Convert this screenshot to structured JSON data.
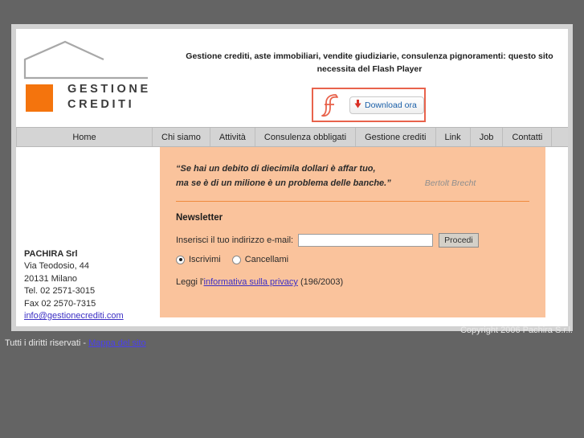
{
  "header": {
    "tagline": "Gestione crediti, aste immobiliari, vendite giudiziarie, consulenza pignoramenti: questo sito necessita del Flash Player",
    "logo_line1": "GESTIONE",
    "logo_line2": "CREDITI",
    "logo_mark_color": "#f4740d",
    "house_icon": "house-outline-icon"
  },
  "flash": {
    "logo_icon": "flash-f-icon",
    "arrow_icon": "download-arrow-icon",
    "download_label": "Download ora",
    "border_color": "#e8634c"
  },
  "nav": {
    "items": [
      {
        "label": "Home",
        "name": "nav-item-home"
      },
      {
        "label": "Chi siamo",
        "name": "nav-item-chi-siamo"
      },
      {
        "label": "Attività",
        "name": "nav-item-attivita"
      },
      {
        "label": "Consulenza obbligati",
        "name": "nav-item-consulenza-obbligati"
      },
      {
        "label": "Gestione crediti",
        "name": "nav-item-gestione-crediti"
      },
      {
        "label": "Link",
        "name": "nav-item-link"
      },
      {
        "label": "Job",
        "name": "nav-item-job"
      },
      {
        "label": "Contatti",
        "name": "nav-item-contatti"
      }
    ]
  },
  "sidebar": {
    "company": "PACHIRA Srl",
    "street": "Via Teodosio, 44",
    "city": "20131 Milano",
    "tel": "Tel. 02 2571-3015",
    "fax": "Fax 02 2570-7315",
    "email": "info@gestionecrediti.com"
  },
  "content": {
    "panel_color": "#fac39c",
    "quote_line1": "“Se hai un debito di diecimila dollari è affar tuo,",
    "quote_line2": "ma se è di un milione è un problema delle banche.”",
    "quote_author": "Bertolt Brecht",
    "newsletter_title": "Newsletter",
    "email_label": "Inserisci il tuo indirizzo e-mail:",
    "email_value": "",
    "email_placeholder": "",
    "submit_label": "Procedi",
    "radio_subscribe": "Iscrivimi",
    "radio_unsubscribe": "Cancellami",
    "privacy_prefix": "Leggi l'",
    "privacy_link": "informativa sulla privacy",
    "privacy_suffix": " (196/2003)"
  },
  "footer": {
    "copyright": "Copyright 2006 Pachira S.r.l.",
    "rights": "Tutti i diritti riservati - ",
    "sitemap_link": "Mappa del sito"
  }
}
